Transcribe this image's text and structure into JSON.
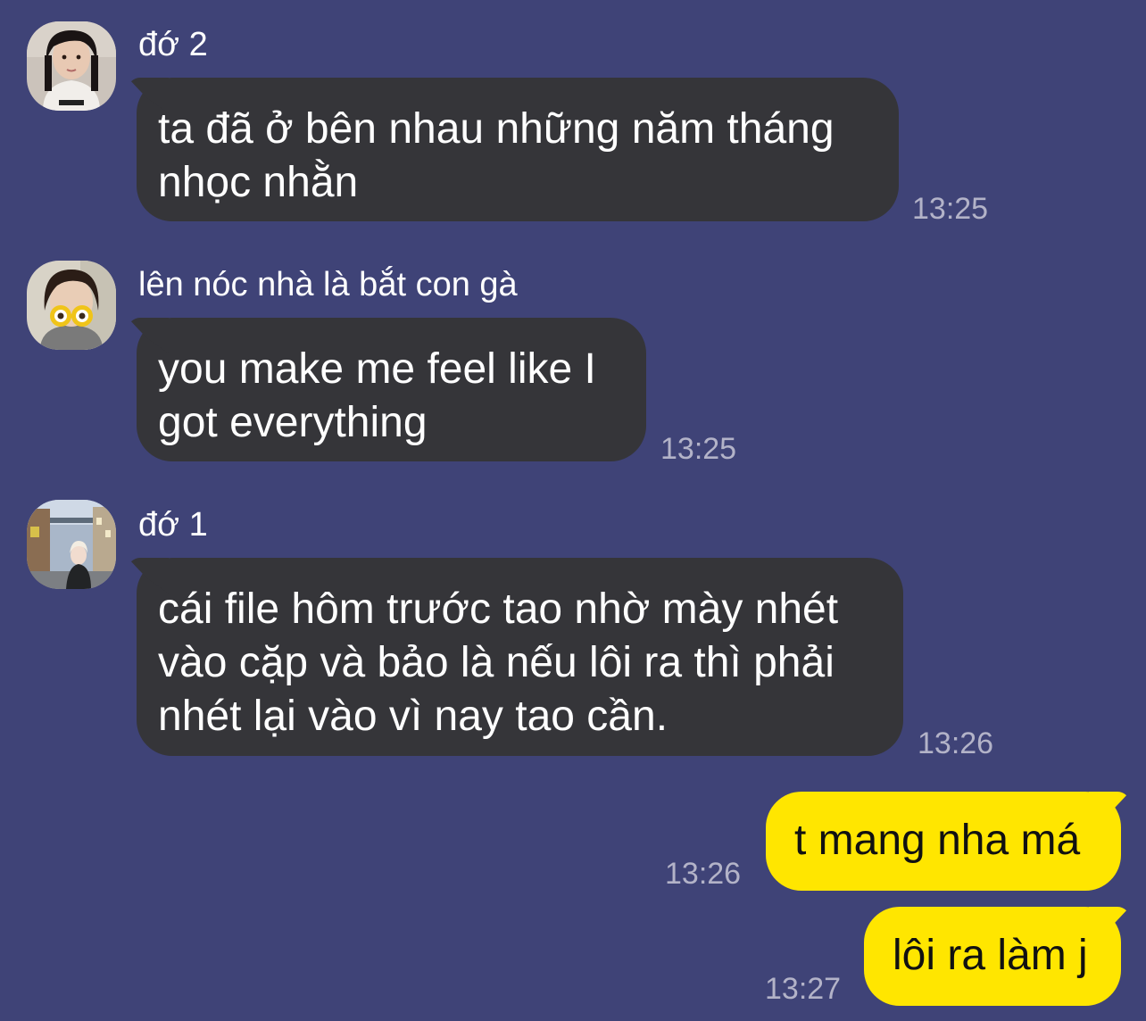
{
  "messages": [
    {
      "sender": "đớ 2",
      "text": "ta đã ở bên nhau những năm tháng nhọc nhằn",
      "time": "13:25",
      "avatar": "avatar-photo-girl-1"
    },
    {
      "sender": "lên nóc nhà là bắt con gà",
      "text": "you make me feel like I got everything",
      "time": "13:25",
      "avatar": "avatar-photo-girl-goggles"
    },
    {
      "sender": "đớ 1",
      "text": "cái file hôm trước tao nhờ mày nhét vào cặp và bảo là nếu lôi ra thì phải nhét lại vào vì nay tao cần.",
      "time": "13:26",
      "avatar": "avatar-photo-street"
    }
  ],
  "outgoing": [
    {
      "text": "t mang nha má",
      "time": "13:26"
    },
    {
      "text": "lôi ra làm j",
      "time": "13:27"
    }
  ],
  "colors": {
    "background": "#3f4377",
    "incoming_bubble": "#353539",
    "outgoing_bubble": "#ffe600",
    "timestamp": "#b3b3c8"
  }
}
